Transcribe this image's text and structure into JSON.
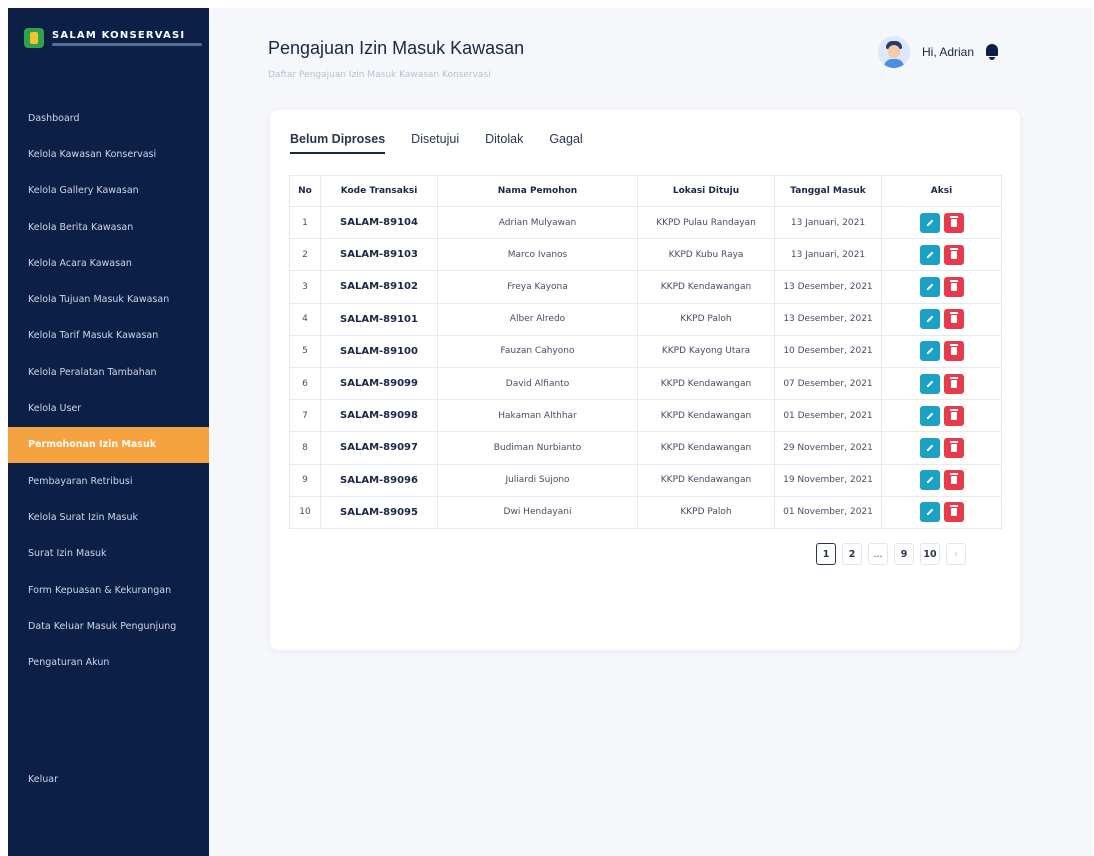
{
  "brand": {
    "name": "SALAM KONSERVASI"
  },
  "sidebar": {
    "items": [
      {
        "label": "Dashboard"
      },
      {
        "label": "Kelola Kawasan Konservasi"
      },
      {
        "label": "Kelola Gallery Kawasan"
      },
      {
        "label": "Kelola Berita Kawasan"
      },
      {
        "label": "Kelola Acara Kawasan"
      },
      {
        "label": "Kelola Tujuan Masuk Kawasan"
      },
      {
        "label": "Kelola Tarif Masuk Kawasan"
      },
      {
        "label": "Kelola Peralatan Tambahan"
      },
      {
        "label": "Kelola User"
      },
      {
        "label": "Permohonan Izin Masuk",
        "active": true
      },
      {
        "label": "Pembayaran Retribusi"
      },
      {
        "label": "Kelola Surat Izin Masuk"
      },
      {
        "label": "Surat Izin Masuk"
      },
      {
        "label": "Form Kepuasan & Kekurangan"
      },
      {
        "label": "Data Keluar Masuk Pengunjung"
      },
      {
        "label": "Pengaturan Akun"
      }
    ],
    "logout": "Keluar",
    "accent_color": "#f4a340",
    "bg_color": "#0b1f47"
  },
  "header": {
    "title": "Pengajuan Izin Masuk Kawasan",
    "subtitle": "Daftar Pengajuan Izin Masuk Kawasan Konservasi",
    "greeting": "Hi, Adrian"
  },
  "tabs": [
    {
      "label": "Belum Diproses",
      "active": true
    },
    {
      "label": "Disetujui"
    },
    {
      "label": "Ditolak"
    },
    {
      "label": "Gagal"
    }
  ],
  "table": {
    "columns": [
      "No",
      "Kode Transaksi",
      "Nama Pemohon",
      "Lokasi Dituju",
      "Tanggal Masuk",
      "Aksi"
    ],
    "rows": [
      [
        "1",
        "SALAM-89104",
        "Adrian Mulyawan",
        "KKPD Pulau Randayan",
        "13 Januari, 2021"
      ],
      [
        "2",
        "SALAM-89103",
        "Marco Ivanos",
        "KKPD Kubu Raya",
        "13 Januari, 2021"
      ],
      [
        "3",
        "SALAM-89102",
        "Freya Kayona",
        "KKPD Kendawangan",
        "13 Desember, 2021"
      ],
      [
        "4",
        "SALAM-89101",
        "Alber Alredo",
        "KKPD Paloh",
        "13 Desember, 2021"
      ],
      [
        "5",
        "SALAM-89100",
        "Fauzan Cahyono",
        "KKPD Kayong Utara",
        "10 Desember, 2021"
      ],
      [
        "6",
        "SALAM-89099",
        "David Alfianto",
        "KKPD Kendawangan",
        "07 Desember, 2021"
      ],
      [
        "7",
        "SALAM-89098",
        "Hakaman Althhar",
        "KKPD Kendawangan",
        "01 Desember, 2021"
      ],
      [
        "8",
        "SALAM-89097",
        "Budiman Nurbianto",
        "KKPD Kendawangan",
        "29 November, 2021"
      ],
      [
        "9",
        "SALAM-89096",
        "Juliardi Sujono",
        "KKPD Kendawangan",
        "19 November, 2021"
      ],
      [
        "10",
        "SALAM-89095",
        "Dwi Hendayani",
        "KKPD Paloh",
        "01 November, 2021"
      ]
    ]
  },
  "pagination": {
    "pages": [
      "1",
      "2",
      "...",
      "9",
      "10"
    ],
    "current": "1",
    "next": "›"
  },
  "icons": {
    "edit": "pencil-icon",
    "delete": "trash-icon",
    "notification": "bell-icon",
    "avatar": "user-avatar"
  },
  "colors": {
    "edit_button": "#1ba1c4",
    "delete_button": "#e63b4a"
  }
}
